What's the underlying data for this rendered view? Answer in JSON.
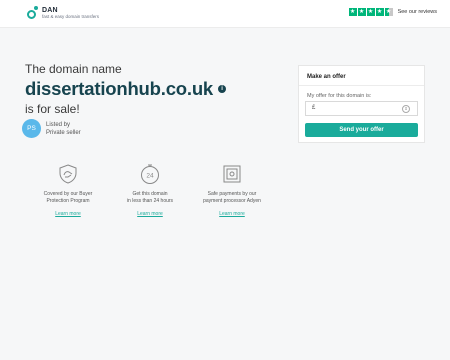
{
  "header": {
    "logo_name": "DAN",
    "logo_tagline": "fast & easy domain transfers",
    "reviews_label": "See our reviews"
  },
  "main": {
    "intro": "The domain name",
    "domain": "dissertationhub.co.uk",
    "sale_text": "is for sale!"
  },
  "seller": {
    "avatar_initials": "PS",
    "listed_label": "Listed by",
    "listed_value": "Private seller"
  },
  "features": [
    {
      "icon": "shield-icon",
      "text_line1": "Covered by our Buyer",
      "text_line2": "Protection Program",
      "link": "Learn more"
    },
    {
      "icon": "clock-24-icon",
      "text_line1": "Get this domain",
      "text_line2": "in less than 24 hours",
      "link": "Learn more"
    },
    {
      "icon": "safe-icon",
      "text_line1": "Safe payments by our",
      "text_line2": "payment processor Adyen",
      "link": "Learn more"
    }
  ],
  "offer": {
    "title": "Make an offer",
    "field_label": "My offer for this domain is:",
    "currency": "£",
    "placeholder": "",
    "button_label": "Send your offer"
  },
  "colors": {
    "accent": "#1aab9b",
    "domain_text": "#17444f",
    "avatar": "#5ab8ea",
    "trustpilot_green": "#00b67a"
  }
}
